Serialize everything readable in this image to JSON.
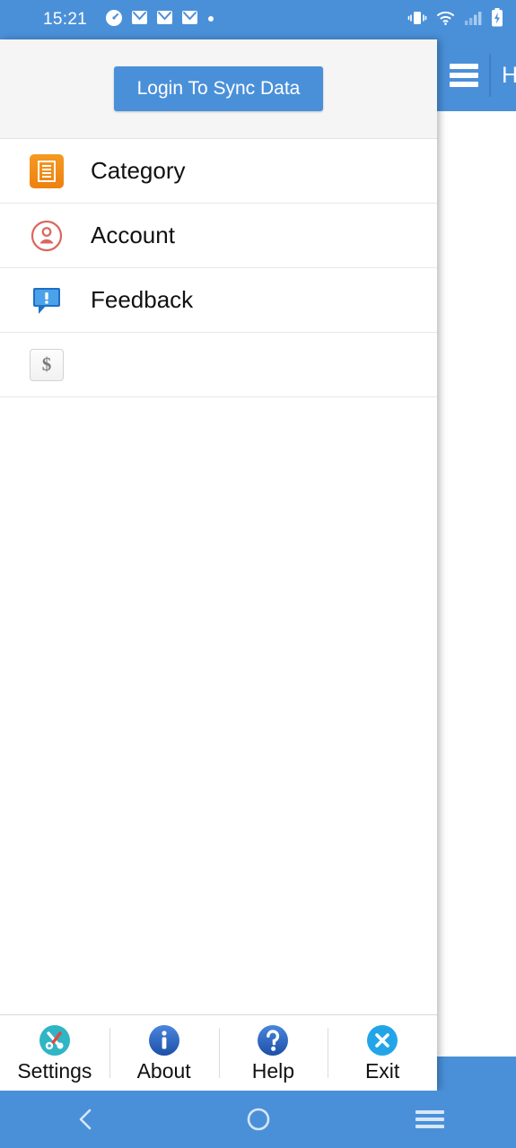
{
  "statusbar": {
    "time": "15:21",
    "left_icons": [
      "clock-icon",
      "mail-icon",
      "mail-icon",
      "mail-icon",
      "dot-icon"
    ],
    "right_icons": [
      "vibrate-icon",
      "wifi-icon",
      "signal-icon",
      "battery-charging-icon"
    ]
  },
  "background_app": {
    "menu_icon": "hamburger-icon",
    "title": "H",
    "bar_color": "#4a90d9"
  },
  "drawer": {
    "login_button": "Login To Sync Data",
    "header_bg": "#f5f5f5",
    "items": [
      {
        "label": "Category",
        "icon": "category-icon",
        "icon_color": "#ee8110"
      },
      {
        "label": "Account",
        "icon": "account-icon",
        "icon_color": "#d9534f"
      },
      {
        "label": "Feedback",
        "icon": "feedback-icon",
        "icon_color": "#2f8ee0"
      },
      {
        "label": "",
        "icon": "dollar-icon",
        "icon_color": "#7a7a7a"
      }
    ]
  },
  "tabbar": {
    "tabs": [
      {
        "label": "Settings",
        "icon": "tools-icon",
        "icon_color": "#2fb5c4"
      },
      {
        "label": "About",
        "icon": "info-icon",
        "icon_color": "#2f6fd0"
      },
      {
        "label": "Help",
        "icon": "question-icon",
        "icon_color": "#2f6fd0"
      },
      {
        "label": "Exit",
        "icon": "close-icon",
        "icon_color": "#22a5e8"
      }
    ]
  },
  "navbar": {
    "back": "back-icon",
    "home": "home-icon",
    "recents": "recents-icon",
    "color": "#4a90d9"
  },
  "theme": {
    "accent": "#4a90d9",
    "text": "#111111",
    "divider": "#e8e8e8"
  }
}
